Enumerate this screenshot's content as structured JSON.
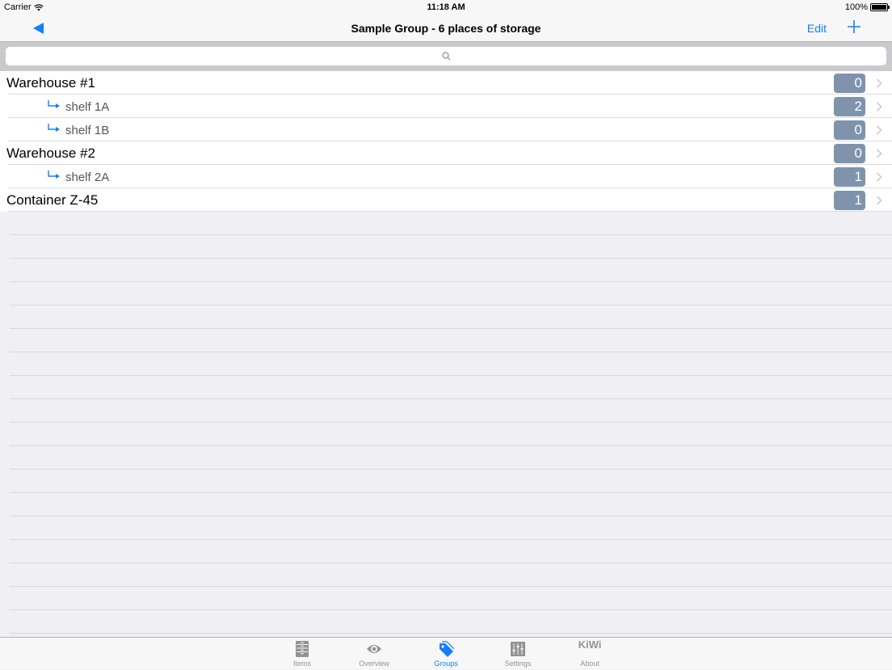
{
  "status_bar": {
    "carrier": "Carrier",
    "time": "11:18 AM",
    "battery": "100%"
  },
  "nav": {
    "title": "Sample Group - 6 places of storage",
    "edit_label": "Edit",
    "accent_color": "#147efb"
  },
  "search": {
    "placeholder": "",
    "value": ""
  },
  "rows": [
    {
      "label": "Warehouse #1",
      "count": "0",
      "level": "top"
    },
    {
      "label": "shelf 1A",
      "count": "2",
      "level": "child"
    },
    {
      "label": "shelf 1B",
      "count": "0",
      "level": "child"
    },
    {
      "label": "Warehouse #2",
      "count": "0",
      "level": "top"
    },
    {
      "label": "shelf 2A",
      "count": "1",
      "level": "child"
    },
    {
      "label": "Container Z-45",
      "count": "1",
      "level": "top"
    }
  ],
  "badge_color": "#7f93ad",
  "tabs": [
    {
      "label": "Items",
      "icon": "cabinet-icon",
      "active": false
    },
    {
      "label": "Overview",
      "icon": "eye-icon",
      "active": false
    },
    {
      "label": "Groups",
      "icon": "tag-icon",
      "active": true
    },
    {
      "label": "Settings",
      "icon": "sliders-icon",
      "active": false
    },
    {
      "label": "About",
      "icon": "kiwi-logo",
      "logo_text": "KiWi",
      "active": false
    }
  ]
}
